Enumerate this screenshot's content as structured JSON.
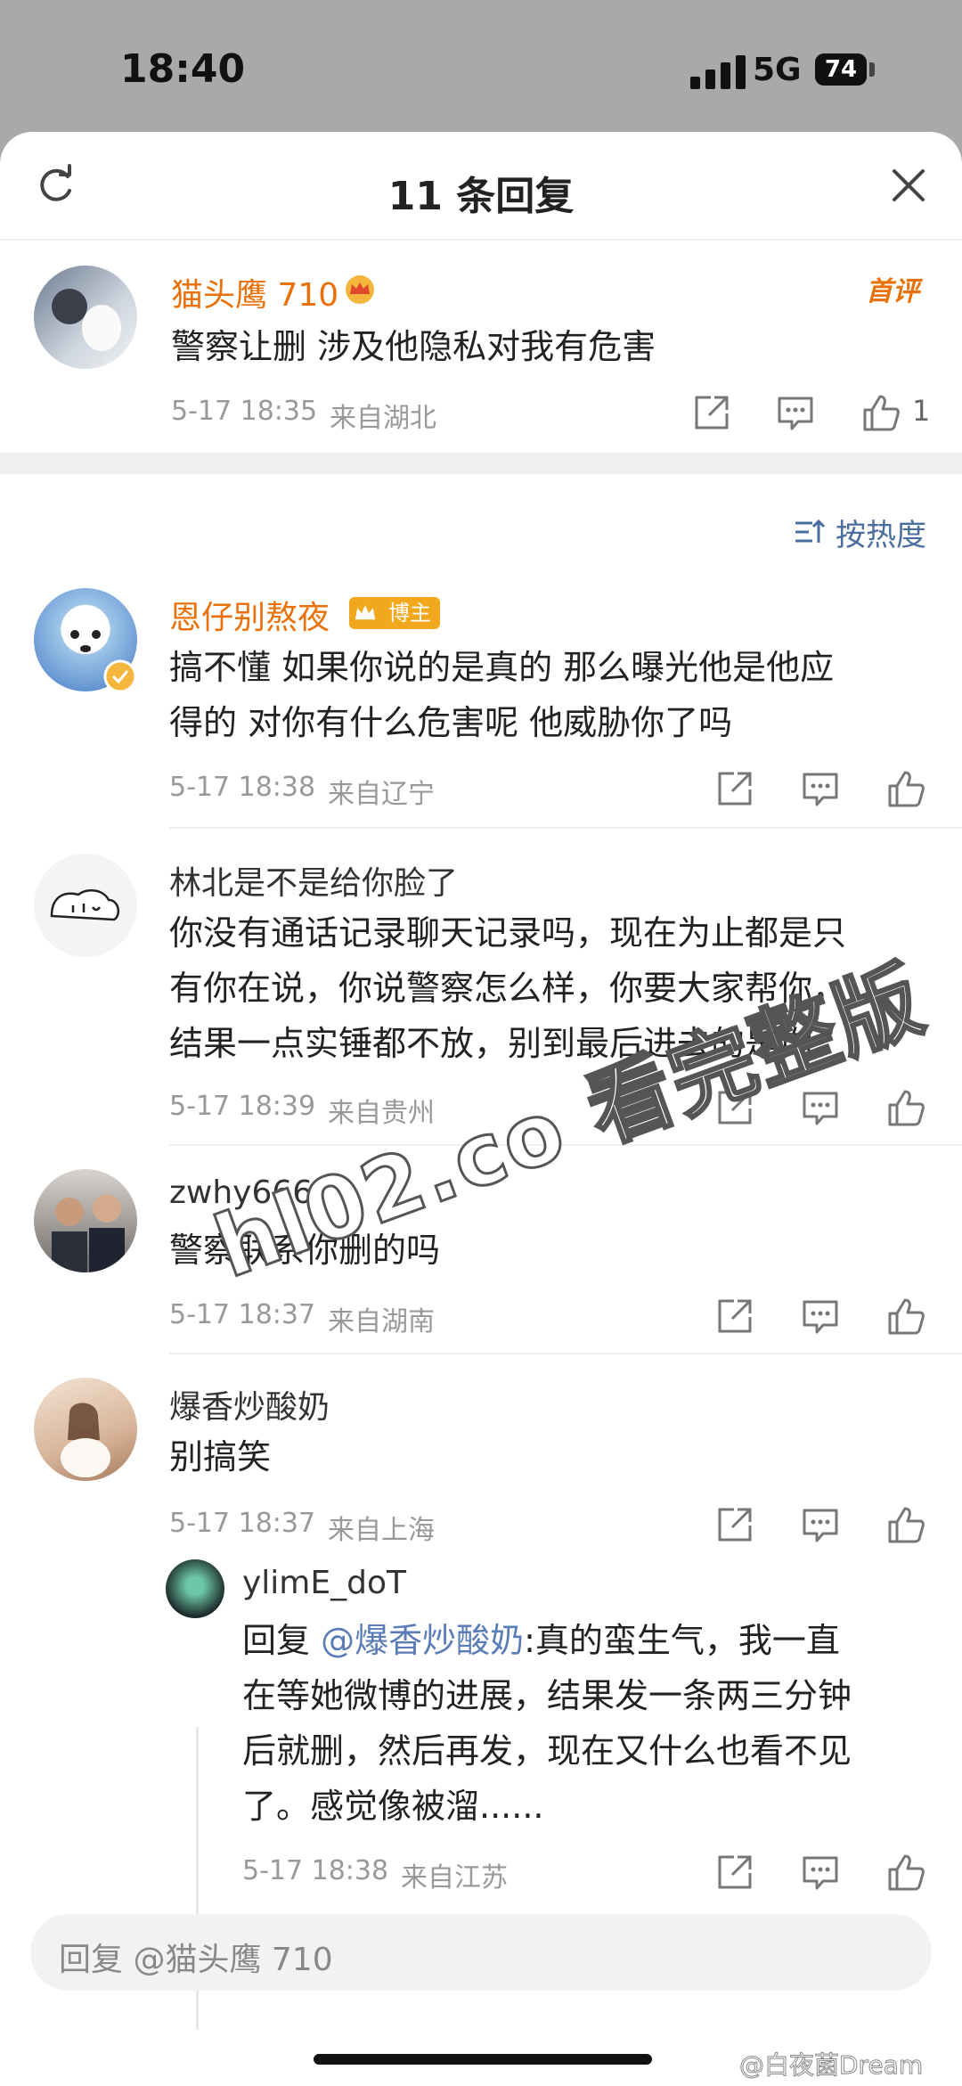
{
  "status_bar": {
    "time": "18:40",
    "network": "5G",
    "battery": "74"
  },
  "header": {
    "title": "11 条回复"
  },
  "main_comment": {
    "user": "猫头鹰 710",
    "tag": "首评",
    "text": "警察让删 涉及他隐私对我有危害",
    "time": "5-17 18:35",
    "location": "来自湖北",
    "likes": "1"
  },
  "sort_label": "按热度",
  "replies": [
    {
      "user": "恩仔别熬夜",
      "badge": "博主",
      "lines": [
        "搞不懂 如果你说的是真的 那么曝光他是他应",
        "得的 对你有什么危害呢 他威胁你了吗"
      ],
      "time": "5-17 18:38",
      "location": "来自辽宁"
    },
    {
      "user": "林北是不是给你脸了",
      "lines": [
        "你没有通话记录聊天记录吗，现在为止都是只",
        "有你在说，你说警察怎么样，你要大家帮你，",
        "结果一点实锤都不放，别到最后进去的是你"
      ],
      "time": "5-17 18:39",
      "location": "来自贵州"
    },
    {
      "user": "zwhy666",
      "lines": [
        "警察联系你删的吗"
      ],
      "time": "5-17 18:37",
      "location": "来自湖南"
    },
    {
      "user": "爆香炒酸奶",
      "lines": [
        "别搞笑"
      ],
      "time": "5-17 18:37",
      "location": "来自上海",
      "sub_reply": {
        "user": "ylimE_doT",
        "reply_prefix": "回复 ",
        "mention": "@爆香炒酸奶",
        "lines": [
          ":真的蛮生气，我一直",
          "在等她微博的进展，结果发一条两三分钟",
          "后就删，然后再发，现在又什么也看不见",
          "了。感觉像被溜......"
        ],
        "time": "5-17 18:38",
        "location": "来自江苏"
      }
    }
  ],
  "reply_input": {
    "placeholder": "回复 @猫头鹰 710"
  },
  "overlay_watermark": "hl02.co 看完整版",
  "source_watermark": "@白夜菌Dream",
  "icons": [
    "refresh-icon",
    "close-icon",
    "share-icon",
    "comment-icon",
    "like-icon",
    "sort-icon",
    "crown-icon",
    "verified-icon"
  ],
  "colors": {
    "accent_orange": "#e8710a",
    "link_blue": "#5a7db7",
    "badge_gold": "#f2a81c"
  }
}
